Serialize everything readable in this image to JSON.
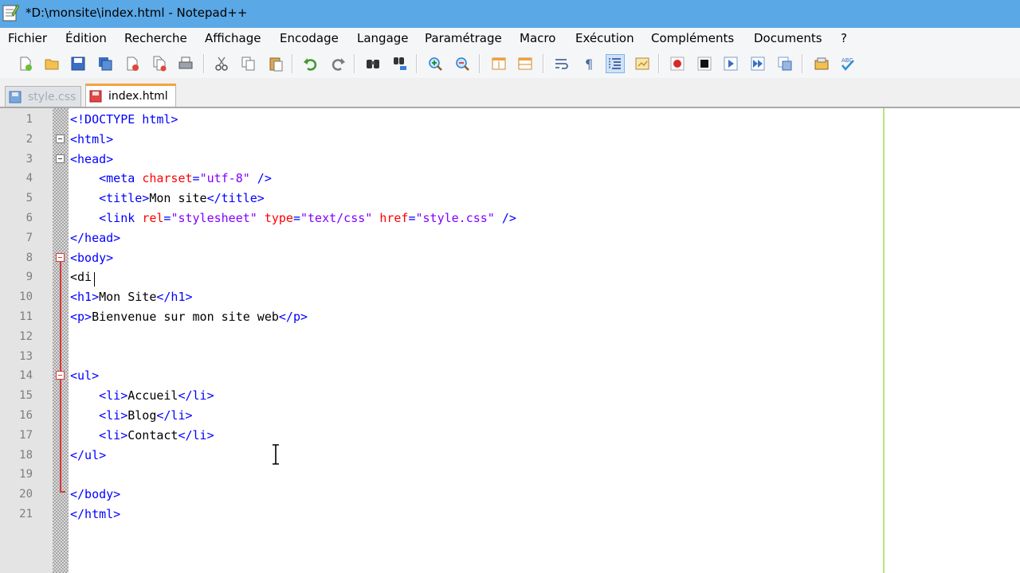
{
  "window": {
    "title": "*D:\\monsite\\index.html - Notepad++"
  },
  "menu": {
    "items": [
      "Fichier",
      "Édition",
      "Recherche",
      "Affichage",
      "Encodage",
      "Langage",
      "Paramétrage",
      "Macro",
      "Exécution",
      "Compléments",
      "Documents",
      "?"
    ]
  },
  "toolbar": {
    "buttons": [
      {
        "icon": "new-file-icon"
      },
      {
        "icon": "open-file-icon"
      },
      {
        "icon": "save-icon"
      },
      {
        "icon": "save-all-icon"
      },
      {
        "icon": "close-icon"
      },
      {
        "icon": "close-all-icon"
      },
      {
        "icon": "print-icon"
      },
      {
        "icon": "cut-icon"
      },
      {
        "icon": "copy-icon"
      },
      {
        "icon": "paste-icon"
      },
      {
        "icon": "undo-icon"
      },
      {
        "icon": "redo-icon"
      },
      {
        "icon": "find-icon"
      },
      {
        "icon": "replace-icon"
      },
      {
        "icon": "zoom-in-icon"
      },
      {
        "icon": "zoom-out-icon"
      },
      {
        "icon": "sync-vertical-icon"
      },
      {
        "icon": "sync-horizontal-icon"
      },
      {
        "icon": "word-wrap-icon"
      },
      {
        "icon": "show-all-characters-icon"
      },
      {
        "icon": "indent-guide-icon",
        "pressed": true
      },
      {
        "icon": "user-language-icon"
      },
      {
        "icon": "record-macro-icon"
      },
      {
        "icon": "stop-recording-icon"
      },
      {
        "icon": "play-macro-icon"
      },
      {
        "icon": "run-macro-multiple-icon"
      },
      {
        "icon": "save-macro-icon"
      },
      {
        "icon": "launch-browser-icon"
      },
      {
        "icon": "spell-check-icon"
      }
    ],
    "spell_check_label": "ABC"
  },
  "tabs": [
    {
      "label": "style.css",
      "active": false
    },
    {
      "label": "index.html",
      "active": true
    }
  ],
  "editor": {
    "lines": [
      {
        "n": "1",
        "tokens": [
          {
            "t": "tag",
            "v": "<!DOCTYPE html>"
          }
        ]
      },
      {
        "n": "2",
        "tokens": [
          {
            "t": "tag",
            "v": "<html>"
          }
        ]
      },
      {
        "n": "3",
        "tokens": [
          {
            "t": "tag",
            "v": "<head>"
          }
        ]
      },
      {
        "n": "4",
        "tokens": [
          {
            "t": "txt",
            "v": "    "
          },
          {
            "t": "tag",
            "v": "<meta "
          },
          {
            "t": "attr",
            "v": "charset"
          },
          {
            "t": "tag",
            "v": "="
          },
          {
            "t": "val",
            "v": "\"utf-8\""
          },
          {
            "t": "tag",
            "v": " />"
          }
        ]
      },
      {
        "n": "5",
        "tokens": [
          {
            "t": "txt",
            "v": "    "
          },
          {
            "t": "tag",
            "v": "<title>"
          },
          {
            "t": "txt",
            "v": "Mon site"
          },
          {
            "t": "tag",
            "v": "</title>"
          }
        ]
      },
      {
        "n": "6",
        "tokens": [
          {
            "t": "txt",
            "v": "    "
          },
          {
            "t": "tag",
            "v": "<link "
          },
          {
            "t": "attr",
            "v": "rel"
          },
          {
            "t": "tag",
            "v": "="
          },
          {
            "t": "val",
            "v": "\"stylesheet\""
          },
          {
            "t": "tag",
            "v": " "
          },
          {
            "t": "attr",
            "v": "type"
          },
          {
            "t": "tag",
            "v": "="
          },
          {
            "t": "val",
            "v": "\"text/css\""
          },
          {
            "t": "tag",
            "v": " "
          },
          {
            "t": "attr",
            "v": "href"
          },
          {
            "t": "tag",
            "v": "="
          },
          {
            "t": "val",
            "v": "\"style.css\""
          },
          {
            "t": "tag",
            "v": " />"
          }
        ]
      },
      {
        "n": "7",
        "tokens": [
          {
            "t": "tag",
            "v": "</head>"
          }
        ]
      },
      {
        "n": "8",
        "tokens": [
          {
            "t": "tag",
            "v": "<body>"
          }
        ]
      },
      {
        "n": "9",
        "tokens": [
          {
            "t": "txt",
            "v": "<di"
          }
        ]
      },
      {
        "n": "10",
        "tokens": [
          {
            "t": "tag",
            "v": "<h1>"
          },
          {
            "t": "txt",
            "v": "Mon Site"
          },
          {
            "t": "tag",
            "v": "</h1>"
          }
        ]
      },
      {
        "n": "11",
        "tokens": [
          {
            "t": "tag",
            "v": "<p>"
          },
          {
            "t": "txt",
            "v": "Bienvenue sur mon site web"
          },
          {
            "t": "tag",
            "v": "</p>"
          }
        ]
      },
      {
        "n": "12",
        "tokens": []
      },
      {
        "n": "13",
        "tokens": []
      },
      {
        "n": "14",
        "tokens": [
          {
            "t": "tag",
            "v": "<ul>"
          }
        ]
      },
      {
        "n": "15",
        "tokens": [
          {
            "t": "txt",
            "v": "    "
          },
          {
            "t": "tag",
            "v": "<li>"
          },
          {
            "t": "txt",
            "v": "Accueil"
          },
          {
            "t": "tag",
            "v": "</li>"
          }
        ]
      },
      {
        "n": "16",
        "tokens": [
          {
            "t": "txt",
            "v": "    "
          },
          {
            "t": "tag",
            "v": "<li>"
          },
          {
            "t": "txt",
            "v": "Blog"
          },
          {
            "t": "tag",
            "v": "</li>"
          }
        ]
      },
      {
        "n": "17",
        "tokens": [
          {
            "t": "txt",
            "v": "    "
          },
          {
            "t": "tag",
            "v": "<li>"
          },
          {
            "t": "txt",
            "v": "Contact"
          },
          {
            "t": "tag",
            "v": "</li>"
          }
        ]
      },
      {
        "n": "18",
        "tokens": [
          {
            "t": "tag",
            "v": "</ul>"
          }
        ]
      },
      {
        "n": "19",
        "tokens": []
      },
      {
        "n": "20",
        "tokens": [
          {
            "t": "tag",
            "v": "</body>"
          }
        ]
      },
      {
        "n": "21",
        "tokens": [
          {
            "t": "tag",
            "v": "</html>"
          }
        ]
      }
    ]
  },
  "colors": {
    "title_bar": "#5ba8e6",
    "tag": "#0000ff",
    "attribute": "#ff0000",
    "attribute_value": "#8000ff",
    "fold_marker": "#d63a3a",
    "active_tab_accent": "#f6a23d",
    "edge_line": "#b6e67a"
  }
}
